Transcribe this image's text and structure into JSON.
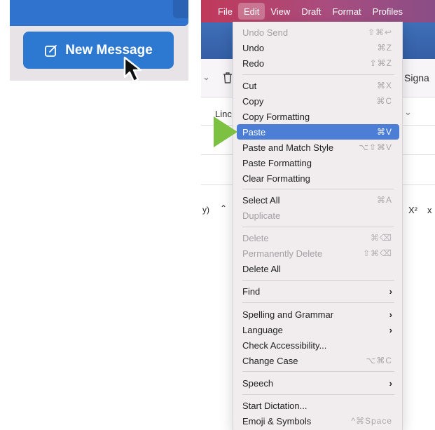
{
  "left_panel": {
    "new_message_label": "New Message",
    "icons": {
      "compose": "compose-icon",
      "cursor": "cursor-arrow-icon"
    },
    "colors": {
      "button": "#2d79d1",
      "topbar": "#2f73cf"
    }
  },
  "menubar": {
    "items": [
      {
        "label": "File"
      },
      {
        "label": "Edit",
        "active": true
      },
      {
        "label": "View"
      },
      {
        "label": "Draft"
      },
      {
        "label": "Format"
      },
      {
        "label": "Profiles"
      }
    ]
  },
  "background": {
    "partial_signature": "Signa",
    "partial_lin": "Linc",
    "partial_y": "y)",
    "superscript": "X²"
  },
  "edit_menu": {
    "highlight_color": "#4c7ed6",
    "items": [
      {
        "label": "Undo Send",
        "shortcut": "⇧⌘↩",
        "disabled": true
      },
      {
        "label": "Undo",
        "shortcut": "⌘Z"
      },
      {
        "label": "Redo",
        "shortcut": "⇧⌘Z"
      },
      {
        "label": "Cut",
        "shortcut": "⌘X"
      },
      {
        "label": "Copy",
        "shortcut": "⌘C"
      },
      {
        "label": "Copy Formatting"
      },
      {
        "label": "Paste",
        "shortcut": "⌘V",
        "highlighted": true
      },
      {
        "label": "Paste and Match Style",
        "shortcut": "⌥⇧⌘V"
      },
      {
        "label": "Paste Formatting"
      },
      {
        "label": "Clear Formatting"
      },
      {
        "label": "Select All",
        "shortcut": "⌘A"
      },
      {
        "label": "Duplicate",
        "disabled": true
      },
      {
        "label": "Delete",
        "shortcut": "⌘⌫",
        "disabled": true
      },
      {
        "label": "Permanently Delete",
        "shortcut": "⇧⌘⌫",
        "disabled": true
      },
      {
        "label": "Delete All"
      },
      {
        "label": "Find",
        "submenu": true
      },
      {
        "label": "Spelling and Grammar",
        "submenu": true
      },
      {
        "label": "Language",
        "submenu": true
      },
      {
        "label": "Check Accessibility..."
      },
      {
        "label": "Change Case",
        "shortcut": "⌥⌘C"
      },
      {
        "label": "Speech",
        "submenu": true
      },
      {
        "label": "Start Dictation..."
      },
      {
        "label": "Emoji & Symbols",
        "shortcut": "^⌘Space"
      }
    ]
  }
}
